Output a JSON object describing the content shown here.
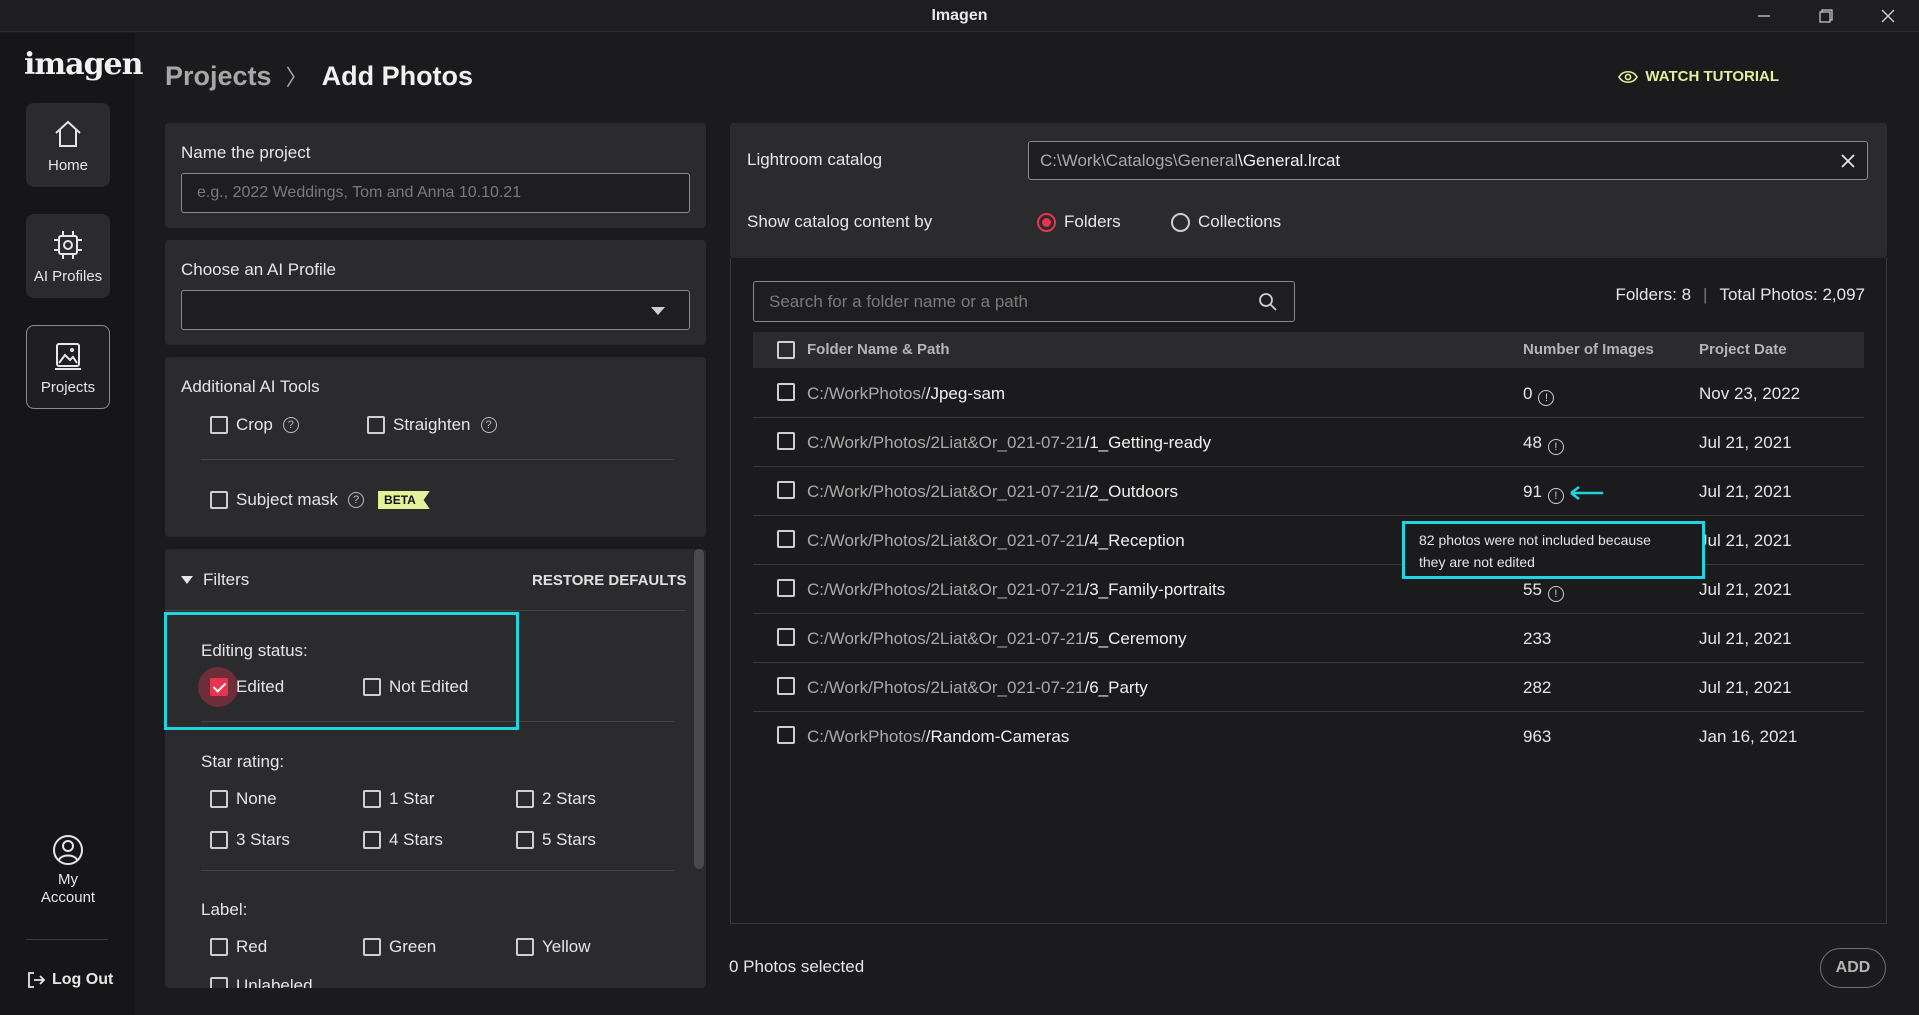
{
  "window": {
    "title": "Imagen"
  },
  "sidebar": {
    "logo": "imagen",
    "items": [
      {
        "label": "Home",
        "icon": "home-icon"
      },
      {
        "label": "AI Profiles",
        "icon": "ai-chip-icon"
      },
      {
        "label": "Projects",
        "icon": "projects-icon"
      }
    ],
    "account_line1": "My",
    "account_line2": "Account",
    "logout": "Log Out"
  },
  "breadcrumb": {
    "root": "Projects",
    "separator": "〉",
    "current": "Add Photos"
  },
  "tutorial": {
    "label": "WATCH TUTORIAL"
  },
  "project_name": {
    "label": "Name the project",
    "placeholder": "e.g., 2022 Weddings, Tom and Anna 10.10.21"
  },
  "ai_profile": {
    "label": "Choose an AI Profile",
    "value": ""
  },
  "ai_tools": {
    "label": "Additional AI Tools",
    "crop": "Crop",
    "straighten": "Straighten",
    "subject_mask": "Subject mask",
    "beta": "BETA"
  },
  "filters": {
    "title": "Filters",
    "restore": "RESTORE DEFAULTS",
    "editing_label": "Editing status:",
    "edited": "Edited",
    "not_edited": "Not Edited",
    "star_label": "Star rating:",
    "stars": [
      "None",
      "1 Star",
      "2 Stars",
      "3 Stars",
      "4 Stars",
      "5 Stars"
    ],
    "label_label": "Label:",
    "labels": [
      "Red",
      "Green",
      "Yellow",
      "Unlabeled"
    ]
  },
  "catalog": {
    "label": "Lightroom catalog",
    "path_dim": "C:\\Work\\Catalogs\\General",
    "path_bright": "\\General.lrcat",
    "show_by": "Show catalog content by",
    "folders": "Folders",
    "collections": "Collections"
  },
  "search": {
    "placeholder": "Search for a folder name or a path"
  },
  "stats": {
    "folders": "Folders: 8",
    "sep": "|",
    "total": "Total Photos: 2,097"
  },
  "table": {
    "col_name": "Folder Name & Path",
    "col_count": "Number of Images",
    "col_date": "Project Date",
    "rows": [
      {
        "dim": "C:/WorkPhotos/",
        "bright": "/Jpeg-sam",
        "count": "0",
        "date": "Nov 23, 2022"
      },
      {
        "dim": "C:/Work/Photos/2Liat&Or_021-07-21",
        "bright": "/1_Getting-ready",
        "count": "48",
        "date": "Jul 21, 2021"
      },
      {
        "dim": "C:/Work/Photos/2Liat&Or_021-07-21",
        "bright": "/2_Outdoors",
        "count": "91",
        "date": "Jul 21, 2021"
      },
      {
        "dim": "C:/Work/Photos/2Liat&Or_021-07-21",
        "bright": "/4_Reception",
        "count": "",
        "date": "Jul 21, 2021"
      },
      {
        "dim": "C:/Work/Photos/2Liat&Or_021-07-21",
        "bright": "/3_Family-portraits",
        "count": "55",
        "date": "Jul 21, 2021"
      },
      {
        "dim": "C:/Work/Photos/2Liat&Or_021-07-21",
        "bright": "/5_Ceremony",
        "count": "233",
        "date": "Jul 21, 2021"
      },
      {
        "dim": "C:/Work/Photos/2Liat&Or_021-07-21",
        "bright": "/6_Party",
        "count": "282",
        "date": "Jul 21, 2021"
      },
      {
        "dim": "C:/WorkPhotos/",
        "bright": "/Random-Cameras",
        "count": "963",
        "date": "Jan 16, 2021"
      }
    ]
  },
  "tooltip": {
    "line1": "82 photos were not included because",
    "line2": "they are not edited"
  },
  "footer": {
    "selected": "0 Photos selected",
    "add": "ADD"
  },
  "colors": {
    "accent": "#e8344f",
    "highlight": "#22d3e0",
    "beta": "#e4f29a"
  }
}
